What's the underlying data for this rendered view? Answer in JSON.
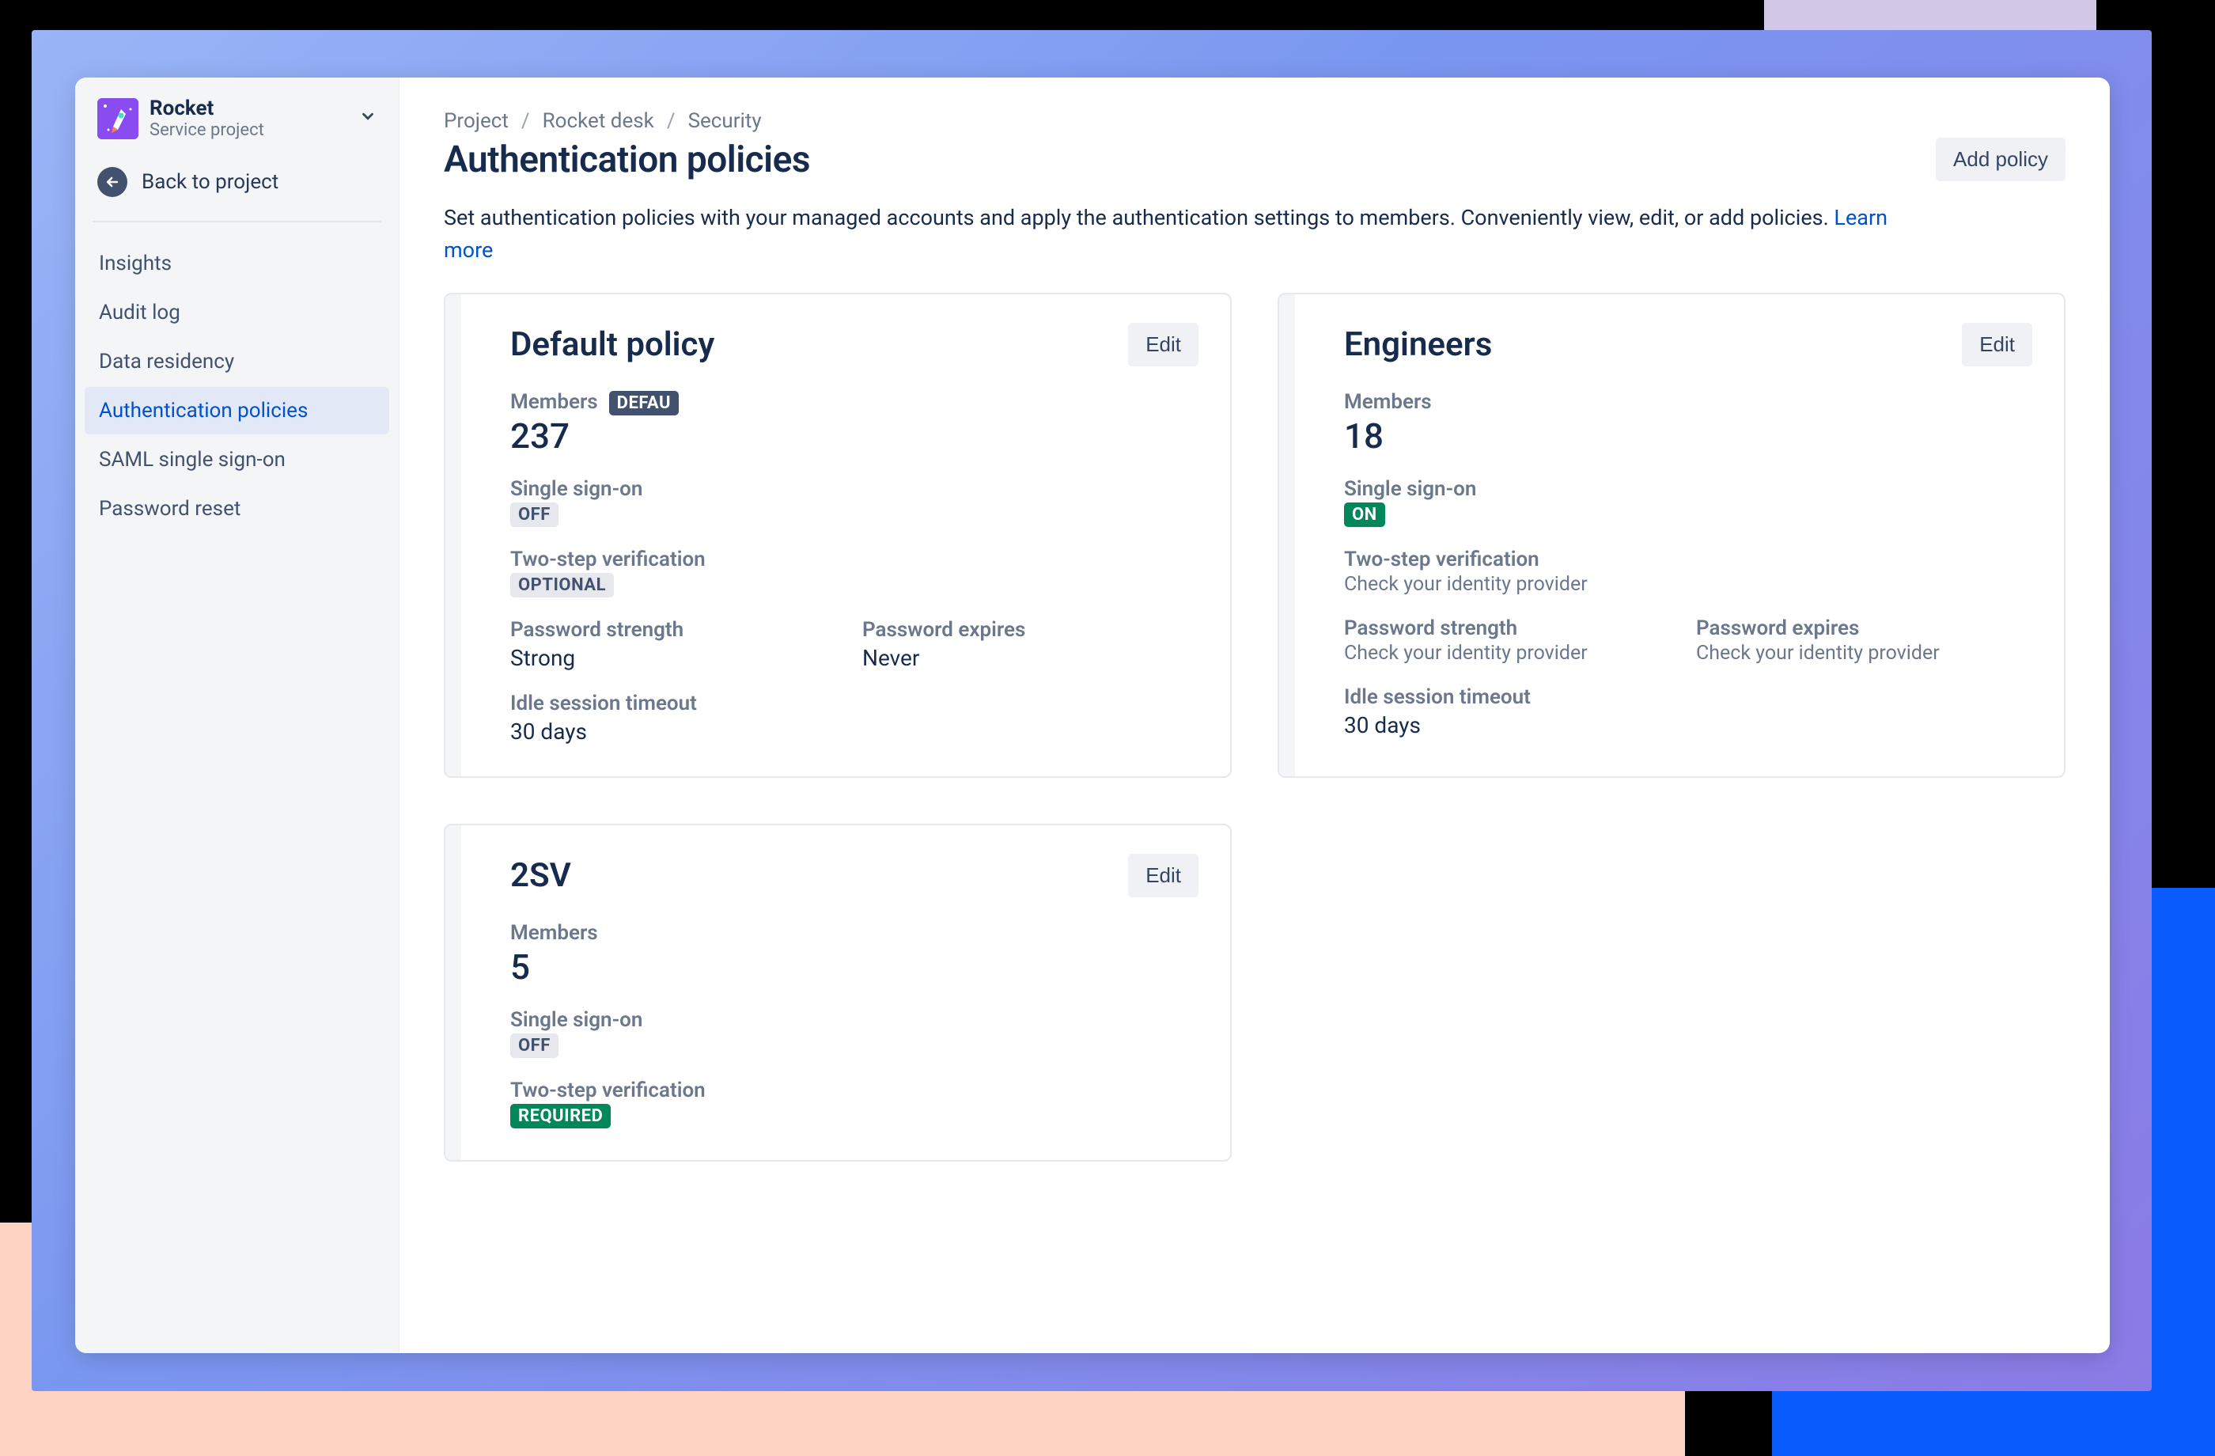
{
  "project": {
    "name": "Rocket",
    "subtitle": "Service project"
  },
  "back_label": "Back to project",
  "nav": [
    "Insights",
    "Audit log",
    "Data residency",
    "Authentication policies",
    "SAML single sign-on",
    "Password reset"
  ],
  "nav_active_index": 3,
  "breadcrumb": {
    "project": "Project",
    "desk": "Rocket desk",
    "section": "Security"
  },
  "page_title": "Authentication policies",
  "add_button": "Add policy",
  "description_text": "Set authentication policies with your managed accounts and apply the authentication settings to members. Conveniently view, edit, or add policies. ",
  "learn_more": "Learn more",
  "labels": {
    "members": "Members",
    "sso": "Single sign-on",
    "twostep": "Two-step verification",
    "pwstrength": "Password strength",
    "pwexpires": "Password expires",
    "idle": "Idle session timeout",
    "edit": "Edit",
    "check_idp": "Check your identity provider"
  },
  "badges": {
    "default": "DEFAU",
    "off": "OFF",
    "on": "ON",
    "optional": "OPTIONAL",
    "required": "REQUIRED"
  },
  "policies": {
    "default": {
      "title": "Default policy",
      "members": "237",
      "pwstrength": "Strong",
      "pwexpires": "Never",
      "idle": "30 days"
    },
    "engineers": {
      "title": "Engineers",
      "members": "18",
      "idle": "30 days"
    },
    "twosv": {
      "title": "2SV",
      "members": "5"
    }
  }
}
